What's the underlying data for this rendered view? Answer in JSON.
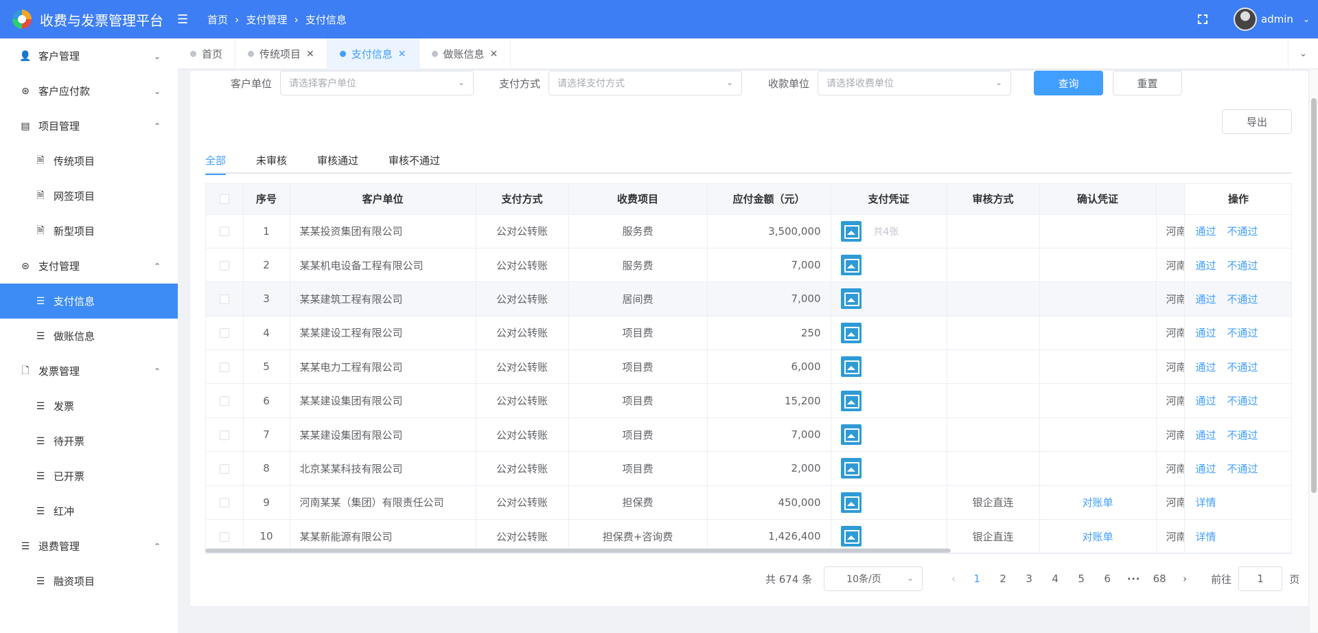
{
  "header": {
    "app_title": "收费与发票管理平台",
    "breadcrumb": [
      "首页",
      "支付管理",
      "支付信息"
    ],
    "username": "admin"
  },
  "sidebar": {
    "groups": [
      {
        "label": "客户管理",
        "icon": "user-icon",
        "arrow": "⌄"
      },
      {
        "label": "客户应付款",
        "icon": "payable-icon",
        "arrow": "⌄"
      },
      {
        "label": "项目管理",
        "icon": "project-icon",
        "arrow": "⌃"
      },
      {
        "label": "支付管理",
        "icon": "payment-icon",
        "arrow": "⌃"
      },
      {
        "label": "发票管理",
        "icon": "invoice-icon",
        "arrow": "⌃"
      },
      {
        "label": "退费管理",
        "icon": "refund-icon",
        "arrow": "⌃"
      }
    ],
    "project_items": [
      "传统项目",
      "网签项目",
      "新型项目"
    ],
    "payment_items": [
      "支付信息",
      "做账信息"
    ],
    "invoice_items": [
      "发票",
      "待开票",
      "已开票",
      "红冲"
    ],
    "refund_items": [
      "融资项目"
    ]
  },
  "tabs": [
    {
      "label": "首页",
      "closable": false,
      "active": false
    },
    {
      "label": "传统项目",
      "closable": true,
      "active": false
    },
    {
      "label": "支付信息",
      "closable": true,
      "active": true
    },
    {
      "label": "做账信息",
      "closable": true,
      "active": false
    }
  ],
  "filters": {
    "customer_label": "客户单位",
    "customer_placeholder": "请选择客户单位",
    "method_label": "支付方式",
    "method_placeholder": "请选择支付方式",
    "payee_label": "收款单位",
    "payee_placeholder": "请选择收费单位",
    "query_button": "查询",
    "reset_button": "重置",
    "export_button": "导出"
  },
  "status_tabs": [
    "全部",
    "未审核",
    "审核通过",
    "审核不通过"
  ],
  "table": {
    "columns": [
      "序号",
      "客户单位",
      "支付方式",
      "收费项目",
      "应付金额（元）",
      "支付凭证",
      "审核方式",
      "确认凭证",
      "",
      "操作"
    ],
    "rows": [
      {
        "no": "1",
        "customer": "某某投资集团有限公司",
        "method": "公对公转账",
        "item": "服务费",
        "amount": "3,500,000",
        "voucher_count": "共4张",
        "audit": "",
        "confirm": "",
        "region": "河南",
        "ops": [
          "通过",
          "不通过"
        ]
      },
      {
        "no": "2",
        "customer": "某某机电设备工程有限公司",
        "method": "公对公转账",
        "item": "服务费",
        "amount": "7,000",
        "voucher_count": "",
        "audit": "",
        "confirm": "",
        "region": "河南",
        "ops": [
          "通过",
          "不通过"
        ]
      },
      {
        "no": "3",
        "customer": "某某建筑工程有限公司",
        "method": "公对公转账",
        "item": "居间费",
        "amount": "7,000",
        "voucher_count": "",
        "audit": "",
        "confirm": "",
        "region": "河南",
        "ops": [
          "通过",
          "不通过"
        ]
      },
      {
        "no": "4",
        "customer": "某某建设工程有限公司",
        "method": "公对公转账",
        "item": "项目费",
        "amount": "250",
        "voucher_count": "",
        "audit": "",
        "confirm": "",
        "region": "河南",
        "ops": [
          "通过",
          "不通过"
        ]
      },
      {
        "no": "5",
        "customer": "某某电力工程有限公司",
        "method": "公对公转账",
        "item": "项目费",
        "amount": "6,000",
        "voucher_count": "",
        "audit": "",
        "confirm": "",
        "region": "河南",
        "ops": [
          "通过",
          "不通过"
        ]
      },
      {
        "no": "6",
        "customer": "某某建设集团有限公司",
        "method": "公对公转账",
        "item": "项目费",
        "amount": "15,200",
        "voucher_count": "",
        "audit": "",
        "confirm": "",
        "region": "河南",
        "ops": [
          "通过",
          "不通过"
        ]
      },
      {
        "no": "7",
        "customer": "某某建设集团有限公司",
        "method": "公对公转账",
        "item": "项目费",
        "amount": "7,000",
        "voucher_count": "",
        "audit": "",
        "confirm": "",
        "region": "河南",
        "ops": [
          "通过",
          "不通过"
        ]
      },
      {
        "no": "8",
        "customer": "北京某某科技有限公司",
        "method": "公对公转账",
        "item": "项目费",
        "amount": "2,000",
        "voucher_count": "",
        "audit": "",
        "confirm": "",
        "region": "河南",
        "ops": [
          "通过",
          "不通过"
        ]
      },
      {
        "no": "9",
        "customer": "河南某某（集团）有限责任公司",
        "method": "公对公转账",
        "item": "担保费",
        "amount": "450,000",
        "voucher_count": "",
        "audit": "银企直连",
        "confirm": "对账单",
        "region": "河南",
        "ops": [
          "详情"
        ]
      },
      {
        "no": "10",
        "customer": "某某新能源有限公司",
        "method": "公对公转账",
        "item": "担保费+咨询费",
        "amount": "1,426,400",
        "voucher_count": "",
        "audit": "银企直连",
        "confirm": "对账单",
        "region": "河南",
        "ops": [
          "详情"
        ]
      }
    ]
  },
  "pagination": {
    "total": "共 674 条",
    "page_size": "10条/页",
    "pages": [
      "1",
      "2",
      "3",
      "4",
      "5",
      "6"
    ],
    "ellipsis": "•••",
    "last_page": "68",
    "current": "1",
    "goto_label": "前往",
    "goto_value": "1",
    "goto_suffix": "页"
  }
}
